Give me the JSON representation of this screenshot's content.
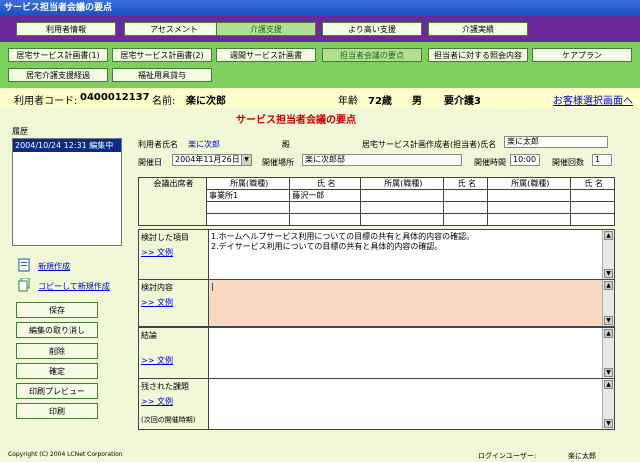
{
  "window": {
    "title": "サービス担当者会議の要点"
  },
  "topnav": [
    "利用者情報",
    "アセスメント",
    "介護支援",
    "より高い支援",
    "介護実績"
  ],
  "subnav": {
    "row1": [
      "居宅サービス計画書(1)",
      "居宅サービス計画書(2)",
      "週間サービス計画書",
      "担当者会議の要点",
      "担当者に対する照会内容",
      "ケアプラン"
    ],
    "row2": [
      "居宅介護支援経過",
      "福祉用具貸与"
    ]
  },
  "info": {
    "user_code_label": "利用者コード:",
    "user_code": "0400012137",
    "name_label": "名前:",
    "name": "楽に次郎",
    "age_label": "年齢",
    "age": "72歳",
    "sex": "男",
    "care_level": "要介護3",
    "select_link": "お客様選択画面へ"
  },
  "page_title": "サービス担当者会議の要点",
  "history": {
    "label": "履歴",
    "items": [
      "2004/10/24 12:31 編集中"
    ]
  },
  "actions": {
    "new_create": "新規作成",
    "copy_create": "コピーして新規作成",
    "save": "保存",
    "undo": "編集の取り消し",
    "delete": "削除",
    "confirm": "確定",
    "print_preview": "印刷プレビュー",
    "print": "印刷"
  },
  "form": {
    "user_name_label": "利用者氏名",
    "user_name": "楽に次郎",
    "honorific": "殿",
    "planner_label": "居宅サービス計画作成者(担当者)氏名",
    "planner": "楽に太郎",
    "date_label": "開催日",
    "date": "2004年11月26日",
    "place_label": "開催場所",
    "place": "楽に次郎邸",
    "time_label": "開催時間",
    "time": "10:00",
    "count_label": "開催回数",
    "count": "1"
  },
  "attendees": {
    "label": "会議出席者",
    "headers": [
      "所属(職種)",
      "氏 名",
      "所属(職種)",
      "氏 名",
      "所属(職種)",
      "氏 名"
    ],
    "rows": [
      [
        "事業所1",
        "藤沢一郎",
        "",
        "",
        "",
        ""
      ],
      [
        "",
        "",
        "",
        "",
        "",
        ""
      ],
      [
        "",
        "",
        "",
        "",
        "",
        ""
      ]
    ]
  },
  "sections": {
    "examined": {
      "label": "検討した項目",
      "link": ">> 文例",
      "lines": [
        "1.ホームヘルプサービス利用についての目標の共有と具体的内容の確認。",
        "2.デイサービス利用についての目標の共有と具体的内容の確認。"
      ]
    },
    "content": {
      "label": "検討内容",
      "link": ">> 文例"
    },
    "conclusion": {
      "label": "結論",
      "link": ">> 文例"
    },
    "remaining": {
      "label": "残された課題",
      "link": ">> 文例",
      "note": "(次回の開催時期)"
    }
  },
  "footer": {
    "copyright": "Copyright (C) 2004 LCNet Corporation",
    "login_label": "ログインユーザー:",
    "login_user": "楽に太郎"
  },
  "colors": {
    "titlebar": "#1a4fc0",
    "topnav": "#6a2a9a",
    "subnav": "#7fcf5f",
    "main": "#f0f8d8",
    "content_area": "#f8d8c0",
    "title_red": "#cc0000"
  }
}
